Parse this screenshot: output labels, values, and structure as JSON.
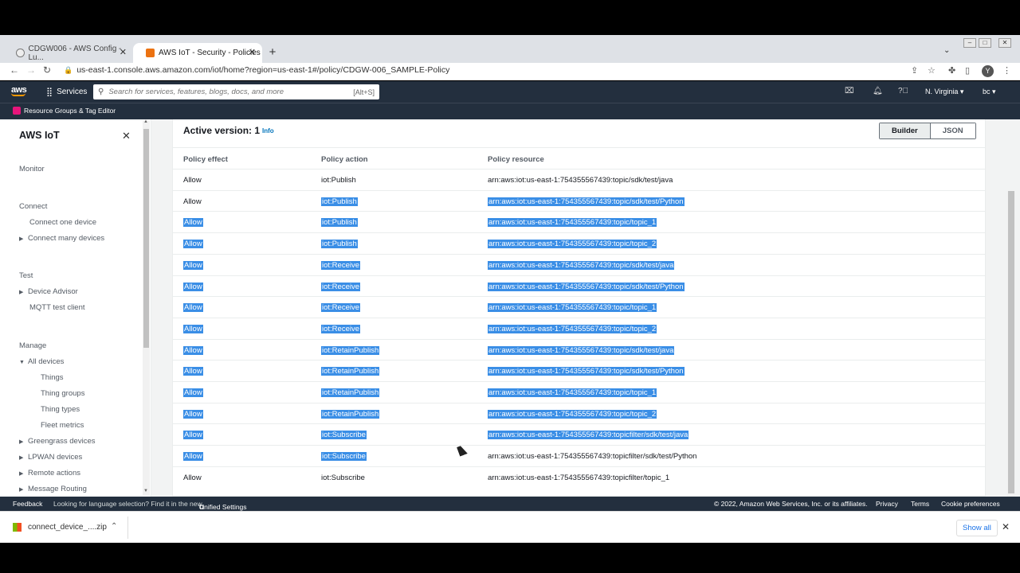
{
  "browser": {
    "tabs": [
      {
        "title": "CDGW006 - AWS Config - Lu..."
      },
      {
        "title": "AWS IoT - Security - Policies"
      }
    ],
    "url": "us-east-1.console.aws.amazon.com/iot/home?region=us-east-1#/policy/CDGW-006_SAMPLE-Policy",
    "profile_initial": "Y"
  },
  "aws_header": {
    "logo": "aws",
    "services_label": "Services",
    "search_placeholder": "Search for services, features, blogs, docs, and more",
    "search_shortcut": "[Alt+S]",
    "region": "N. Virginia ▾",
    "account": "bc ▾",
    "resource_groups": "Resource Groups & Tag Editor"
  },
  "sidebar": {
    "title": "AWS IoT",
    "sections": {
      "monitor": "Monitor",
      "connect": "Connect",
      "connect_one": "Connect one device",
      "connect_many": "Connect many devices",
      "test": "Test",
      "device_advisor": "Device Advisor",
      "mqtt": "MQTT test client",
      "manage": "Manage",
      "all_devices": "All devices",
      "things": "Things",
      "thing_groups": "Thing groups",
      "thing_types": "Thing types",
      "fleet_metrics": "Fleet metrics",
      "greengrass": "Greengrass devices",
      "lpwan": "LPWAN devices",
      "remote_actions": "Remote actions",
      "message_routing": "Message Routing"
    }
  },
  "panel": {
    "active_version": "Active version: 1",
    "info": "Info",
    "builder": "Builder",
    "json": "JSON",
    "columns": [
      "Policy effect",
      "Policy action",
      "Policy resource"
    ],
    "rows": [
      {
        "effect": "Allow",
        "action": "iot:Publish",
        "resource": "arn:aws:iot:us-east-1:754355567439:topic/sdk/test/java",
        "hl": [
          false,
          false,
          false
        ]
      },
      {
        "effect": "Allow",
        "action": "iot:Publish",
        "resource": "arn:aws:iot:us-east-1:754355567439:topic/sdk/test/Python",
        "hl": [
          false,
          true,
          true
        ]
      },
      {
        "effect": "Allow",
        "action": "iot:Publish",
        "resource": "arn:aws:iot:us-east-1:754355567439:topic/topic_1",
        "hl": [
          true,
          true,
          true
        ]
      },
      {
        "effect": "Allow",
        "action": "iot:Publish",
        "resource": "arn:aws:iot:us-east-1:754355567439:topic/topic_2",
        "hl": [
          true,
          true,
          true
        ]
      },
      {
        "effect": "Allow",
        "action": "iot:Receive",
        "resource": "arn:aws:iot:us-east-1:754355567439:topic/sdk/test/java",
        "hl": [
          true,
          true,
          true
        ]
      },
      {
        "effect": "Allow",
        "action": "iot:Receive",
        "resource": "arn:aws:iot:us-east-1:754355567439:topic/sdk/test/Python",
        "hl": [
          true,
          true,
          true
        ]
      },
      {
        "effect": "Allow",
        "action": "iot:Receive",
        "resource": "arn:aws:iot:us-east-1:754355567439:topic/topic_1",
        "hl": [
          true,
          true,
          true
        ]
      },
      {
        "effect": "Allow",
        "action": "iot:Receive",
        "resource": "arn:aws:iot:us-east-1:754355567439:topic/topic_2",
        "hl": [
          true,
          true,
          true
        ]
      },
      {
        "effect": "Allow",
        "action": "iot:RetainPublish",
        "resource": "arn:aws:iot:us-east-1:754355567439:topic/sdk/test/java",
        "hl": [
          true,
          true,
          true
        ]
      },
      {
        "effect": "Allow",
        "action": "iot:RetainPublish",
        "resource": "arn:aws:iot:us-east-1:754355567439:topic/sdk/test/Python",
        "hl": [
          true,
          true,
          true
        ]
      },
      {
        "effect": "Allow",
        "action": "iot:RetainPublish",
        "resource": "arn:aws:iot:us-east-1:754355567439:topic/topic_1",
        "hl": [
          true,
          true,
          true
        ]
      },
      {
        "effect": "Allow",
        "action": "iot:RetainPublish",
        "resource": "arn:aws:iot:us-east-1:754355567439:topic/topic_2",
        "hl": [
          true,
          true,
          true
        ]
      },
      {
        "effect": "Allow",
        "action": "iot:Subscribe",
        "resource": "arn:aws:iot:us-east-1:754355567439:topicfilter/sdk/test/java",
        "hl": [
          true,
          true,
          true
        ]
      },
      {
        "effect": "Allow",
        "action": "iot:Subscribe",
        "resource": "arn:aws:iot:us-east-1:754355567439:topicfilter/sdk/test/Python",
        "hl": [
          true,
          true,
          false
        ]
      },
      {
        "effect": "Allow",
        "action": "iot:Subscribe",
        "resource": "arn:aws:iot:us-east-1:754355567439:topicfilter/topic_1",
        "hl": [
          false,
          false,
          false
        ]
      }
    ]
  },
  "footer": {
    "feedback": "Feedback",
    "lang_note": "Looking for language selection? Find it in the new",
    "unified": "Unified Settings",
    "copyright": "© 2022, Amazon Web Services, Inc. or its affiliates.",
    "privacy": "Privacy",
    "terms": "Terms",
    "cookies": "Cookie preferences"
  },
  "downloads": {
    "file": "connect_device_....zip",
    "show_all": "Show all"
  },
  "colors": {
    "selection": "#3a8ee6",
    "aws_nav": "#232f3e",
    "aws_orange": "#ff9900",
    "link": "#0073bb"
  }
}
